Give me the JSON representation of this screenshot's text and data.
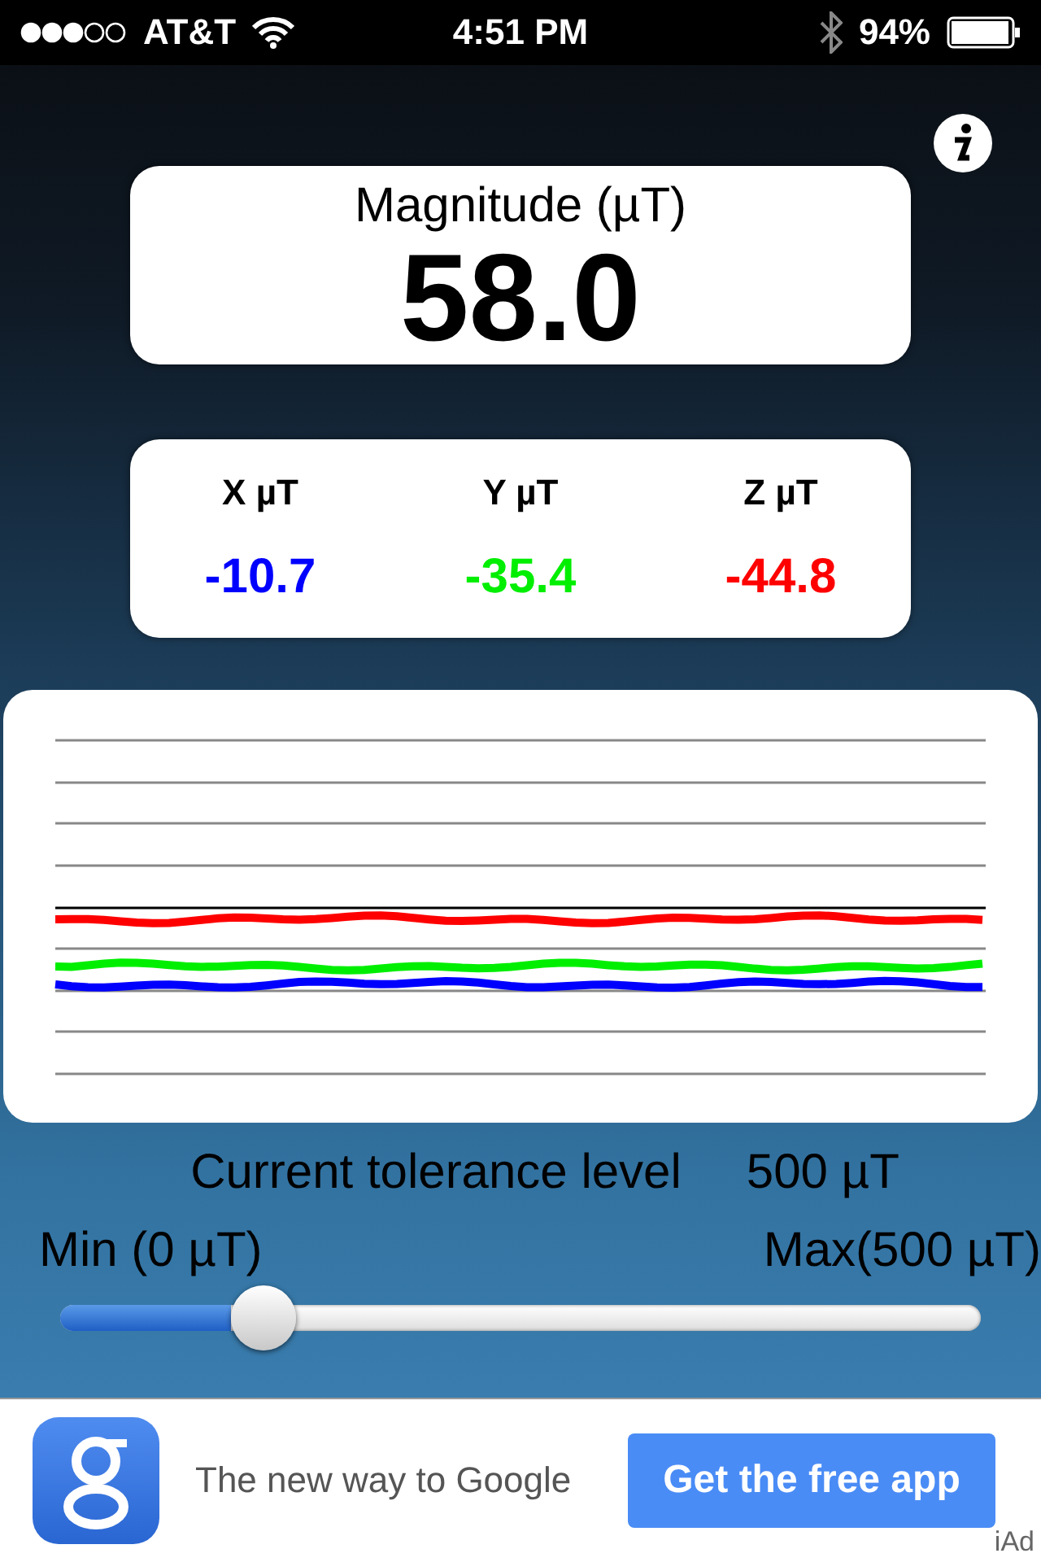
{
  "status_bar": {
    "carrier": "AT&T",
    "time": "4:51 PM",
    "battery": "94%"
  },
  "magnitude": {
    "label": "Magnitude (µT)",
    "value": "58.0"
  },
  "axes": [
    {
      "label": "X µT",
      "value": "-10.7",
      "color": "#0000ff"
    },
    {
      "label": "Y µT",
      "value": "-35.4",
      "color": "#00ee00"
    },
    {
      "label": "Z µT",
      "value": "-44.8",
      "color": "#ff0000"
    }
  ],
  "tolerance": {
    "label": "Current tolerance level",
    "value": "500 µT",
    "min_label": "Min (0 µT)",
    "max_label": "Max(500 µT)",
    "level": 0.22
  },
  "ad": {
    "text": "The new way to Google",
    "button": "Get the free app",
    "badge": "iAd"
  }
}
